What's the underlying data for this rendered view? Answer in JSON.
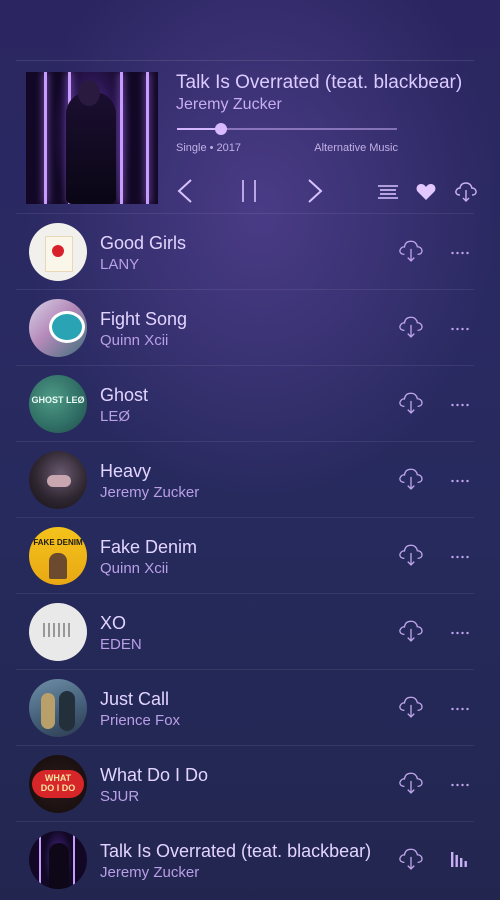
{
  "now_playing": {
    "title": "Talk Is Overrated (teat. blackbear)",
    "artist": "Jeremy Zucker",
    "meta": "Single • 2017",
    "genre": "Alternative Music",
    "progress": 0.2
  },
  "colors": {
    "accent": "#d9b9ff",
    "background": "#2a2a62"
  },
  "tracks": [
    {
      "title": "Good Girls",
      "artist": "LANY"
    },
    {
      "title": "Fight Song",
      "artist": "Quinn Xcii"
    },
    {
      "title": "Ghost",
      "artist": "LEØ",
      "thumb_text": "GHOST LEØ"
    },
    {
      "title": "Heavy",
      "artist": "Jeremy Zucker"
    },
    {
      "title": "Fake Denim",
      "artist": "Quinn Xcii",
      "thumb_text": "FAKE DENIM"
    },
    {
      "title": "XO",
      "artist": "EDEN"
    },
    {
      "title": "Just Call",
      "artist": "Prience Fox"
    },
    {
      "title": "What Do I Do",
      "artist": "SJUR",
      "thumb_text": "WHAT DO I DO"
    },
    {
      "title": "Talk Is Overrated (teat. blackbear)",
      "artist": "Jeremy Zucker"
    }
  ]
}
